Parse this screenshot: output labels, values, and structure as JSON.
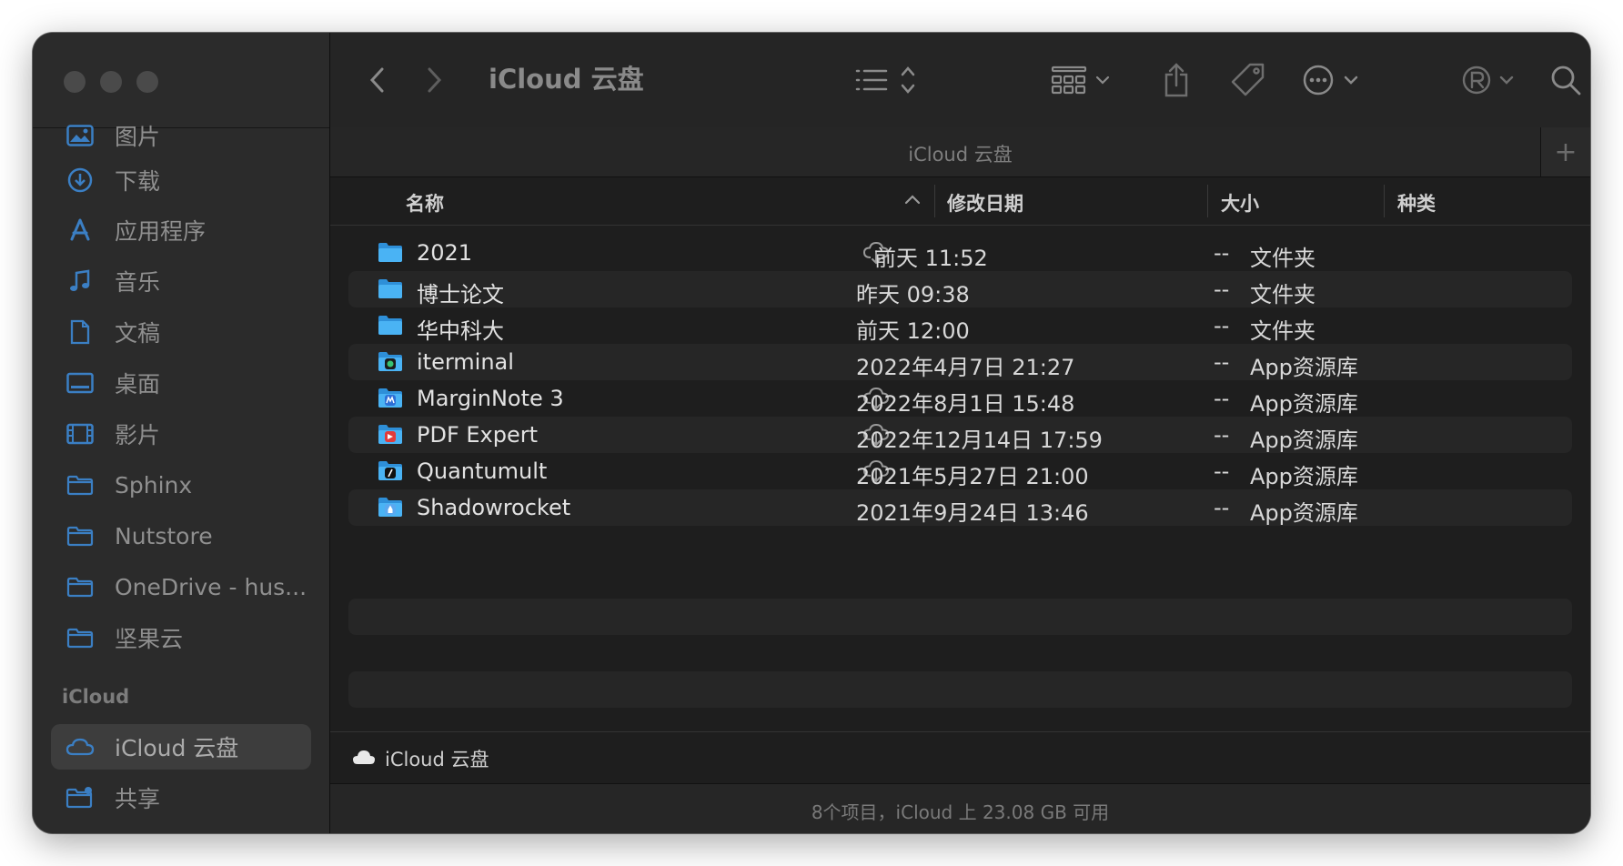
{
  "window": {
    "title": "iCloud 云盘"
  },
  "sidebar": {
    "items": [
      {
        "label": "图片",
        "icon": "photos-icon"
      },
      {
        "label": "下载",
        "icon": "download-icon"
      },
      {
        "label": "应用程序",
        "icon": "applications-icon"
      },
      {
        "label": "音乐",
        "icon": "music-icon"
      },
      {
        "label": "文稿",
        "icon": "document-icon"
      },
      {
        "label": "桌面",
        "icon": "desktop-icon"
      },
      {
        "label": "影片",
        "icon": "movies-icon"
      },
      {
        "label": "Sphinx",
        "icon": "folder-icon"
      },
      {
        "label": "Nutstore",
        "icon": "folder-icon"
      },
      {
        "label": "OneDrive - hus...",
        "icon": "folder-icon"
      },
      {
        "label": "坚果云",
        "icon": "folder-icon"
      }
    ],
    "section_icloud": "iCloud",
    "icloud_items": [
      {
        "label": "iCloud 云盘",
        "icon": "cloud-icon",
        "active": true
      },
      {
        "label": "共享",
        "icon": "shared-folder-icon"
      }
    ]
  },
  "toolbar": {
    "title": "iCloud 云盘",
    "icons": [
      "back-icon",
      "forward-icon",
      "list-view-icon",
      "group-icon",
      "share-icon",
      "tag-icon",
      "more-icon",
      "registered-icon",
      "search-icon"
    ]
  },
  "tabbar": {
    "title": "iCloud 云盘",
    "add_label": "+"
  },
  "columns": {
    "name": "名称",
    "date": "修改日期",
    "size": "大小",
    "kind": "种类"
  },
  "files": [
    {
      "name": "2021",
      "type": "folder",
      "cloud": true,
      "date": "前天 11:52",
      "size": "--",
      "kind": "文件夹"
    },
    {
      "name": "博士论文",
      "type": "folder",
      "cloud": false,
      "date": "昨天 09:38",
      "size": "--",
      "kind": "文件夹"
    },
    {
      "name": "华中科大",
      "type": "folder",
      "cloud": false,
      "date": "前天 12:00",
      "size": "--",
      "kind": "文件夹"
    },
    {
      "name": "iterminal",
      "type": "app-library",
      "cloud": false,
      "date": "2022年4月7日 21:27",
      "size": "--",
      "kind": "App资源库"
    },
    {
      "name": "MarginNote 3",
      "type": "app-library",
      "cloud": true,
      "date": "2022年8月1日 15:48",
      "size": "--",
      "kind": "App资源库"
    },
    {
      "name": "PDF Expert",
      "type": "app-library",
      "cloud": true,
      "date": "2022年12月14日 17:59",
      "size": "--",
      "kind": "App资源库"
    },
    {
      "name": "Quantumult",
      "type": "app-library",
      "cloud": true,
      "date": "2021年5月27日 21:00",
      "size": "--",
      "kind": "App资源库"
    },
    {
      "name": "Shadowrocket",
      "type": "app-library",
      "cloud": false,
      "date": "2021年9月24日 13:46",
      "size": "--",
      "kind": "App资源库"
    }
  ],
  "pathbar": {
    "label": "iCloud 云盘"
  },
  "status": {
    "text": "8个项目，iCloud 上 23.08 GB 可用"
  },
  "colors": {
    "folder": "#3aa8f0",
    "window_bg": "#1e1e1e",
    "sidebar_bg": "#2b2b2b"
  }
}
